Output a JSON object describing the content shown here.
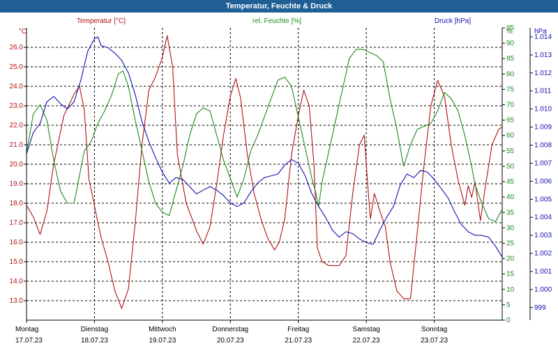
{
  "window": {
    "title": "Temperatur, Feuchte & Druck"
  },
  "colors": {
    "temperature": "#b01010",
    "humidity": "#1a8a1a",
    "pressure": "#1010b0",
    "grid": "#000000",
    "titlebar": "#1f5f96"
  },
  "chart_data": {
    "type": "line",
    "title": "Temperatur, Feuchte & Druck",
    "x_range": [
      0,
      7.0
    ],
    "day_labels": [
      {
        "day": "Montag",
        "date": "17.07.23"
      },
      {
        "day": "Dienstag",
        "date": "18.07.23"
      },
      {
        "day": "Mittwoch",
        "date": "19.07.23"
      },
      {
        "day": "Donnerstag",
        "date": "20.07.23"
      },
      {
        "day": "Freitag",
        "date": "21.07.23"
      },
      {
        "day": "Samstag",
        "date": "22.07.23"
      },
      {
        "day": "Sonntag",
        "date": "23.07.23"
      }
    ],
    "axes": {
      "temperature": {
        "label": "Temperatur [°C]",
        "unit": "°C",
        "range": [
          12.0,
          27.0
        ],
        "ticks": [
          "13.0",
          "14.0",
          "15.0",
          "16.0",
          "17.0",
          "18.0",
          "19.0",
          "20.0",
          "21.0",
          "22.0",
          "23.0",
          "24.0",
          "25.0",
          "26.0"
        ]
      },
      "humidity": {
        "label": "rel. Feuchte [%]",
        "unit": "%",
        "range": [
          0,
          95
        ],
        "ticks": [
          "0",
          "5",
          "10",
          "15",
          "20",
          "25",
          "30",
          "35",
          "40",
          "45",
          "50",
          "55",
          "60",
          "65",
          "70",
          "75",
          "80",
          "85",
          "90",
          "95"
        ]
      },
      "pressure": {
        "label": "Druck [hPa]",
        "unit": "hPa",
        "range": [
          998.3,
          1014.5
        ],
        "ticks": [
          "999",
          "1.000",
          "1.001",
          "1.002",
          "1.003",
          "1.004",
          "1.005",
          "1.006",
          "1.007",
          "1.008",
          "1.009",
          "1.010",
          "1.011",
          "1.012",
          "1.013",
          "1.014"
        ]
      }
    },
    "series": [
      {
        "name": "Temperatur [°C]",
        "axis": "temperature",
        "points": [
          [
            0,
            17.9
          ],
          [
            0.1,
            17.3
          ],
          [
            0.2,
            16.4
          ],
          [
            0.3,
            17.6
          ],
          [
            0.4,
            20.0
          ],
          [
            0.55,
            22.5
          ],
          [
            0.7,
            23.6
          ],
          [
            0.78,
            24.0
          ],
          [
            0.85,
            22.8
          ],
          [
            0.92,
            19.2
          ],
          [
            0.97,
            18.4
          ],
          [
            1.02,
            17.5
          ],
          [
            1.1,
            16.2
          ],
          [
            1.2,
            15.0
          ],
          [
            1.3,
            13.5
          ],
          [
            1.4,
            12.6
          ],
          [
            1.5,
            13.6
          ],
          [
            1.6,
            17.0
          ],
          [
            1.7,
            21.0
          ],
          [
            1.8,
            23.8
          ],
          [
            1.9,
            24.5
          ],
          [
            2.0,
            25.5
          ],
          [
            2.07,
            26.6
          ],
          [
            2.15,
            25.0
          ],
          [
            2.22,
            20.5
          ],
          [
            2.35,
            18.0
          ],
          [
            2.5,
            16.6
          ],
          [
            2.6,
            15.9
          ],
          [
            2.7,
            16.8
          ],
          [
            2.8,
            19.0
          ],
          [
            2.9,
            21.5
          ],
          [
            3.0,
            23.5
          ],
          [
            3.08,
            24.4
          ],
          [
            3.15,
            23.4
          ],
          [
            3.25,
            20.5
          ],
          [
            3.35,
            18.5
          ],
          [
            3.45,
            17.2
          ],
          [
            3.55,
            16.2
          ],
          [
            3.65,
            15.6
          ],
          [
            3.72,
            16.0
          ],
          [
            3.8,
            17.2
          ],
          [
            3.9,
            20.5
          ],
          [
            4.0,
            22.5
          ],
          [
            4.08,
            23.8
          ],
          [
            4.16,
            23.0
          ],
          [
            4.23,
            20.0
          ],
          [
            4.28,
            15.7
          ],
          [
            4.35,
            15.0
          ],
          [
            4.45,
            14.8
          ],
          [
            4.6,
            14.8
          ],
          [
            4.7,
            15.3
          ],
          [
            4.8,
            18.5
          ],
          [
            4.9,
            21.0
          ],
          [
            4.97,
            21.5
          ],
          [
            5.02,
            19.0
          ],
          [
            5.06,
            17.2
          ],
          [
            5.12,
            18.5
          ],
          [
            5.2,
            17.6
          ],
          [
            5.28,
            16.8
          ],
          [
            5.35,
            15.0
          ],
          [
            5.45,
            13.5
          ],
          [
            5.55,
            13.1
          ],
          [
            5.65,
            13.1
          ],
          [
            5.75,
            16.5
          ],
          [
            5.85,
            20.0
          ],
          [
            5.95,
            23.0
          ],
          [
            6.05,
            24.3
          ],
          [
            6.15,
            23.5
          ],
          [
            6.25,
            21.0
          ],
          [
            6.35,
            19.2
          ],
          [
            6.45,
            17.9
          ],
          [
            6.5,
            18.9
          ],
          [
            6.55,
            18.3
          ],
          [
            6.6,
            19.1
          ],
          [
            6.68,
            17.1
          ],
          [
            6.75,
            18.8
          ],
          [
            6.85,
            21.0
          ],
          [
            6.95,
            21.8
          ],
          [
            7.0,
            21.9
          ]
        ]
      },
      {
        "name": "rel. Feuchte [%]",
        "axis": "humidity",
        "points": [
          [
            0,
            54
          ],
          [
            0.1,
            67
          ],
          [
            0.2,
            70
          ],
          [
            0.3,
            65
          ],
          [
            0.4,
            52
          ],
          [
            0.5,
            42
          ],
          [
            0.6,
            38
          ],
          [
            0.7,
            38
          ],
          [
            0.78,
            47
          ],
          [
            0.85,
            55
          ],
          [
            0.95,
            58
          ],
          [
            1.05,
            64
          ],
          [
            1.15,
            68
          ],
          [
            1.25,
            73
          ],
          [
            1.35,
            80
          ],
          [
            1.42,
            81
          ],
          [
            1.5,
            76
          ],
          [
            1.6,
            65
          ],
          [
            1.7,
            55
          ],
          [
            1.8,
            45
          ],
          [
            1.9,
            38
          ],
          [
            2.0,
            35
          ],
          [
            2.1,
            34
          ],
          [
            2.2,
            42
          ],
          [
            2.3,
            50
          ],
          [
            2.4,
            60
          ],
          [
            2.5,
            67
          ],
          [
            2.6,
            69
          ],
          [
            2.7,
            68
          ],
          [
            2.8,
            60
          ],
          [
            2.9,
            52
          ],
          [
            3.0,
            46
          ],
          [
            3.1,
            40
          ],
          [
            3.2,
            46
          ],
          [
            3.3,
            55
          ],
          [
            3.4,
            60
          ],
          [
            3.5,
            66
          ],
          [
            3.6,
            72
          ],
          [
            3.7,
            78
          ],
          [
            3.8,
            79
          ],
          [
            3.9,
            76
          ],
          [
            4.0,
            66
          ],
          [
            4.1,
            56
          ],
          [
            4.2,
            46
          ],
          [
            4.25,
            42
          ],
          [
            4.3,
            37
          ],
          [
            4.35,
            45
          ],
          [
            4.45,
            55
          ],
          [
            4.55,
            65
          ],
          [
            4.65,
            75
          ],
          [
            4.75,
            85
          ],
          [
            4.85,
            88
          ],
          [
            4.95,
            88
          ],
          [
            5.05,
            87
          ],
          [
            5.15,
            86
          ],
          [
            5.25,
            84
          ],
          [
            5.35,
            72
          ],
          [
            5.45,
            62
          ],
          [
            5.55,
            50
          ],
          [
            5.65,
            57
          ],
          [
            5.75,
            62
          ],
          [
            5.85,
            63
          ],
          [
            5.95,
            64
          ],
          [
            6.05,
            68
          ],
          [
            6.15,
            74
          ],
          [
            6.25,
            72
          ],
          [
            6.35,
            68
          ],
          [
            6.45,
            60
          ],
          [
            6.55,
            50
          ],
          [
            6.6,
            44
          ],
          [
            6.7,
            38
          ],
          [
            6.8,
            33
          ],
          [
            6.9,
            32
          ],
          [
            7.0,
            36
          ]
        ]
      },
      {
        "name": "Druck [hPa]",
        "axis": "pressure",
        "points": [
          [
            0,
            1007.5
          ],
          [
            0.1,
            1008.7
          ],
          [
            0.2,
            1009.2
          ],
          [
            0.3,
            1010.4
          ],
          [
            0.4,
            1010.7
          ],
          [
            0.5,
            1010.3
          ],
          [
            0.6,
            1010.0
          ],
          [
            0.7,
            1010.4
          ],
          [
            0.8,
            1011.6
          ],
          [
            0.9,
            1013.2
          ],
          [
            1.0,
            1013.9
          ],
          [
            1.05,
            1014.0
          ],
          [
            1.1,
            1013.5
          ],
          [
            1.2,
            1013.4
          ],
          [
            1.3,
            1013.1
          ],
          [
            1.4,
            1012.7
          ],
          [
            1.5,
            1012.0
          ],
          [
            1.6,
            1010.8
          ],
          [
            1.7,
            1009.3
          ],
          [
            1.8,
            1008.2
          ],
          [
            1.9,
            1007.3
          ],
          [
            2.0,
            1006.5
          ],
          [
            2.1,
            1005.9
          ],
          [
            2.2,
            1006.2
          ],
          [
            2.3,
            1006.1
          ],
          [
            2.4,
            1005.7
          ],
          [
            2.5,
            1005.3
          ],
          [
            2.6,
            1005.5
          ],
          [
            2.7,
            1005.7
          ],
          [
            2.8,
            1005.5
          ],
          [
            2.9,
            1005.2
          ],
          [
            3.0,
            1004.8
          ],
          [
            3.1,
            1004.6
          ],
          [
            3.2,
            1004.8
          ],
          [
            3.3,
            1005.4
          ],
          [
            3.4,
            1005.9
          ],
          [
            3.5,
            1006.2
          ],
          [
            3.6,
            1006.3
          ],
          [
            3.7,
            1006.4
          ],
          [
            3.8,
            1006.9
          ],
          [
            3.9,
            1007.2
          ],
          [
            4.0,
            1007.0
          ],
          [
            4.1,
            1006.3
          ],
          [
            4.2,
            1005.3
          ],
          [
            4.3,
            1004.6
          ],
          [
            4.4,
            1004.0
          ],
          [
            4.5,
            1003.3
          ],
          [
            4.6,
            1002.9
          ],
          [
            4.7,
            1003.2
          ],
          [
            4.8,
            1003.1
          ],
          [
            4.9,
            1002.8
          ],
          [
            5.0,
            1002.6
          ],
          [
            5.1,
            1002.5
          ],
          [
            5.2,
            1003.3
          ],
          [
            5.3,
            1004.0
          ],
          [
            5.4,
            1004.6
          ],
          [
            5.5,
            1005.8
          ],
          [
            5.6,
            1006.4
          ],
          [
            5.7,
            1006.2
          ],
          [
            5.8,
            1006.6
          ],
          [
            5.9,
            1006.5
          ],
          [
            6.0,
            1006.1
          ],
          [
            6.1,
            1005.6
          ],
          [
            6.2,
            1005.1
          ],
          [
            6.3,
            1004.3
          ],
          [
            6.4,
            1003.6
          ],
          [
            6.5,
            1003.2
          ],
          [
            6.6,
            1003.0
          ],
          [
            6.7,
            1003.0
          ],
          [
            6.8,
            1002.9
          ],
          [
            6.9,
            1002.4
          ],
          [
            7.0,
            1001.8
          ]
        ]
      }
    ]
  }
}
